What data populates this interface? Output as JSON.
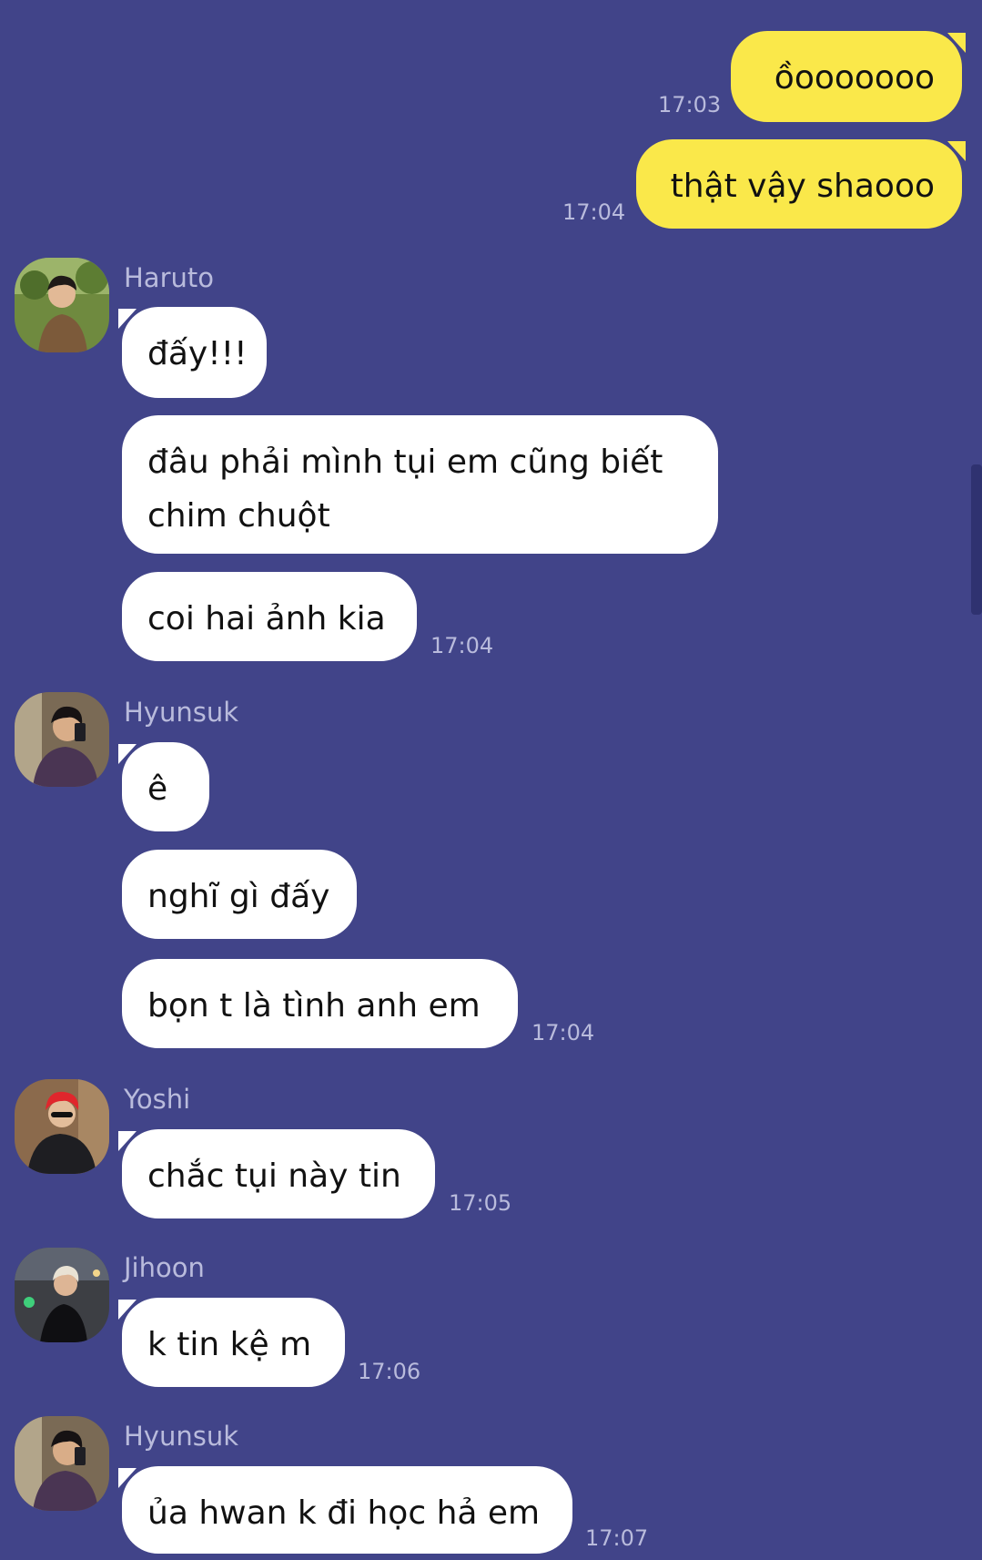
{
  "colors": {
    "background": "#414489",
    "incoming_bubble": "#ffffff",
    "outgoing_bubble": "#fae84a",
    "meta_text": "#b9bbdc"
  },
  "messages": {
    "out1": {
      "text": "ồooooooo",
      "time": "17:03"
    },
    "out2": {
      "text": "thật vậy shaooo",
      "time": "17:04"
    },
    "haruto": {
      "name": "Haruto",
      "avatar_icon": "user-avatar-icon",
      "msg1": "đấy!!!",
      "msg2": "đâu phải mình tụi em cũng biết chim chuột",
      "msg3": "coi hai ảnh kia",
      "time": "17:04"
    },
    "hyunsuk1": {
      "name": "Hyunsuk",
      "avatar_icon": "user-avatar-icon",
      "msg1": "ê",
      "msg2": "nghĩ gì đấy",
      "msg3": "bọn t là tình anh em",
      "time": "17:04"
    },
    "yoshi": {
      "name": "Yoshi",
      "avatar_icon": "user-avatar-icon",
      "msg1": "chắc tụi này tin",
      "time": "17:05"
    },
    "jihoon": {
      "name": "Jihoon",
      "avatar_icon": "user-avatar-icon",
      "msg1": "k tin kệ m",
      "time": "17:06"
    },
    "hyunsuk2": {
      "name": "Hyunsuk",
      "avatar_icon": "user-avatar-icon",
      "msg1": "ủa hwan k đi học hả em",
      "time": "17:07"
    }
  }
}
